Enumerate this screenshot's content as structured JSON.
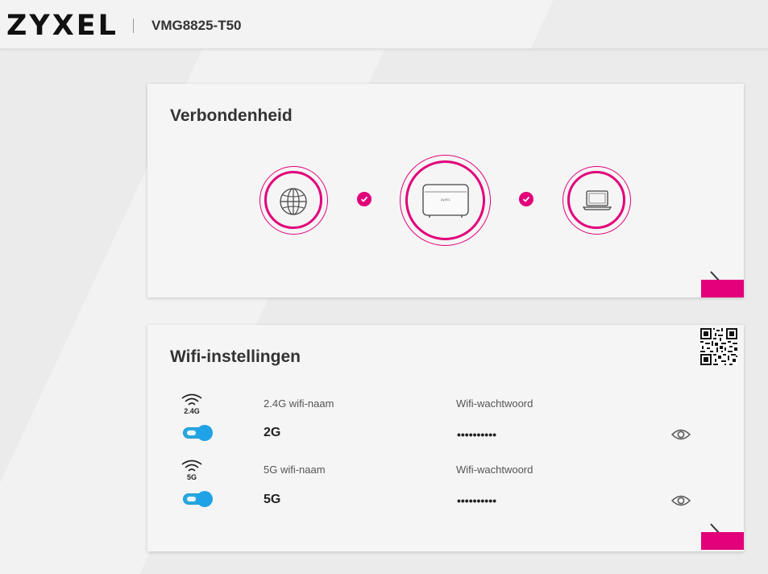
{
  "header": {
    "brand": "ZYXEL",
    "model": "VMG8825-T50"
  },
  "connectivity": {
    "title": "Verbondenheid",
    "nodes": [
      {
        "name": "internet",
        "icon": "globe-icon"
      },
      {
        "name": "router",
        "icon": "router-icon"
      },
      {
        "name": "device",
        "icon": "laptop-icon"
      }
    ],
    "status_icon": "check-icon"
  },
  "wifi": {
    "title": "Wifi-instellingen",
    "networks": [
      {
        "band": "2.4G",
        "name_label": "2.4G wifi-naam",
        "name": "2G",
        "password_label": "Wifi-wachtwoord",
        "password": "••••••••••",
        "enabled": true
      },
      {
        "band": "5G",
        "name_label": "5G wifi-naam",
        "name": "5G",
        "password_label": "Wifi-wachtwoord",
        "password": "••••••••••",
        "enabled": true
      }
    ]
  },
  "colors": {
    "accent": "#e2007a",
    "toggle": "#1fa3e6"
  }
}
